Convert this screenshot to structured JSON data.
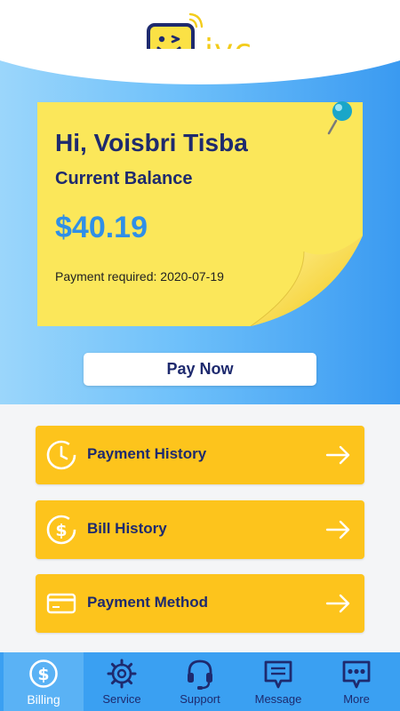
{
  "brand": {
    "name": "ivc"
  },
  "hero": {
    "greeting": "Hi, Voisbri Tisba",
    "balance_label": "Current Balance",
    "balance_amount": "$40.19",
    "payment_required": "Payment required: 2020-07-19"
  },
  "pay_button": {
    "label": "Pay Now"
  },
  "menu": [
    {
      "label": "Payment History",
      "icon": "clock-icon"
    },
    {
      "label": "Bill History",
      "icon": "dollar-coin-icon"
    },
    {
      "label": "Payment Method",
      "icon": "credit-card-icon"
    }
  ],
  "nav": [
    {
      "label": "Billing",
      "icon": "dollar-icon",
      "active": true
    },
    {
      "label": "Service",
      "icon": "gear-icon",
      "active": false
    },
    {
      "label": "Support",
      "icon": "headset-icon",
      "active": false
    },
    {
      "label": "Message",
      "icon": "message-icon",
      "active": false
    },
    {
      "label": "More",
      "icon": "more-icon",
      "active": false
    }
  ],
  "colors": {
    "navy": "#1e2a6e",
    "yellow_button": "#fdc41c",
    "note_yellow": "#fbe75a",
    "balance_blue": "#2f8fe8",
    "nav_blue": "#3aa0f2"
  }
}
